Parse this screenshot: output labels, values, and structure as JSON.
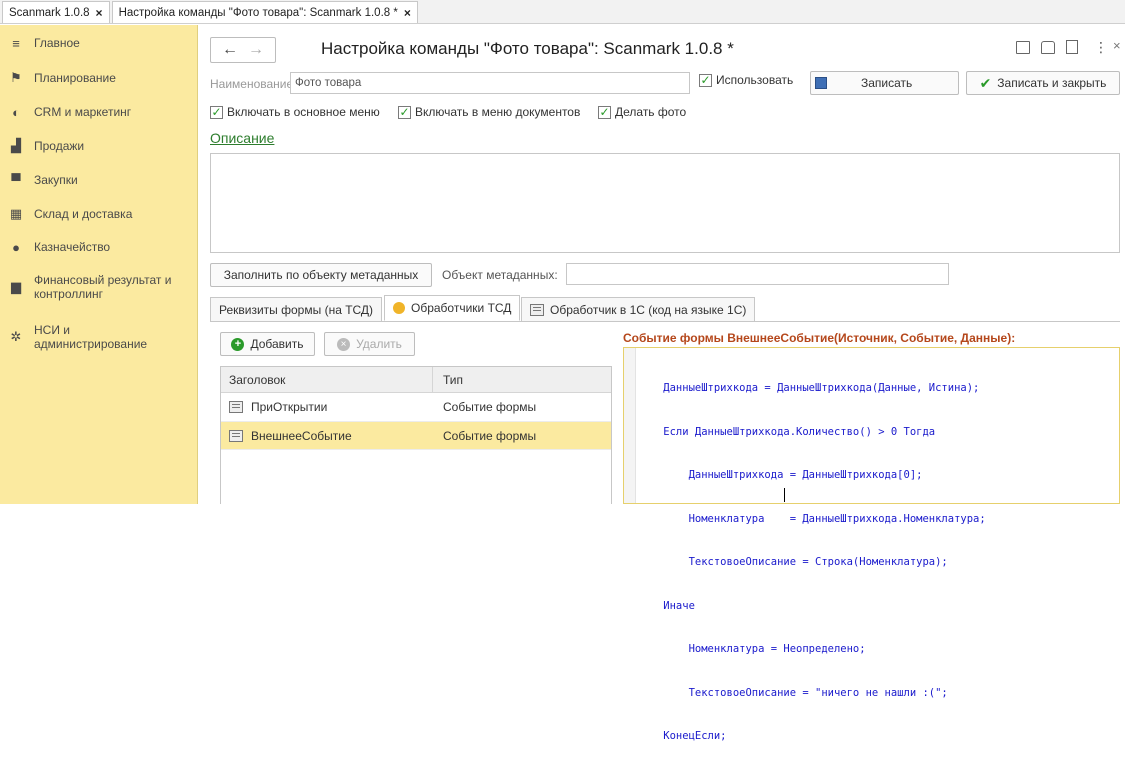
{
  "window_tabs": [
    {
      "label": "Scanmark 1.0.8",
      "close": "×"
    },
    {
      "label": "Настройка команды \"Фото товара\": Scanmark 1.0.8 *",
      "close": "×"
    }
  ],
  "sidebar": {
    "items": [
      {
        "label": "Главное",
        "icon": "menu-icon"
      },
      {
        "label": "Планирование",
        "icon": "planning-icon"
      },
      {
        "label": "CRM и маркетинг",
        "icon": "crm-icon"
      },
      {
        "label": "Продажи",
        "icon": "bag-icon"
      },
      {
        "label": "Закупки",
        "icon": "cart-icon"
      },
      {
        "label": "Склад и доставка",
        "icon": "warehouse-icon"
      },
      {
        "label": "Казначейство",
        "icon": "coin-icon"
      },
      {
        "label": "Финансовый результат и контроллинг",
        "icon": "chart-icon"
      },
      {
        "label": "НСИ и администрирование",
        "icon": "gear-icon"
      }
    ]
  },
  "header": {
    "back": "←",
    "forward": "→",
    "title": "Настройка команды \"Фото товара\": Scanmark 1.0.8 *",
    "more": "⋮",
    "close": "×"
  },
  "form": {
    "name_label": "Наименование:",
    "name_value": "Фото товара",
    "use_label": "Использовать",
    "save_label": "Записать",
    "save_close_label": "Записать и закрыть",
    "cb_main_menu": "Включать в основное меню",
    "cb_doc_menu": "Включать в меню документов",
    "cb_photo": "Делать фото",
    "description_link": "Описание",
    "fill_button": "Заполнить по объекту метаданных",
    "metadata_label": "Объект метаданных:",
    "metadata_value": ""
  },
  "tabs": [
    {
      "label": "Реквизиты формы (на ТСД)"
    },
    {
      "label": "Обработчики ТСД"
    },
    {
      "label": "Обработчик в 1С  (код на языке 1С)"
    }
  ],
  "handlers": {
    "add_label": "Добавить",
    "delete_label": "Удалить",
    "columns": [
      "Заголовок",
      "Тип"
    ],
    "rows": [
      {
        "title": "ПриОткрытии",
        "type": "Событие формы"
      },
      {
        "title": "ВнешнееСобытие",
        "type": "Событие формы"
      }
    ]
  },
  "code": {
    "header": "Событие формы ВнешнееСобытие(Источник, Событие, Данные):",
    "lines": [
      "    ДанныеШтрихкода = ДанныеШтрихкода(Данные, Истина);",
      "    Если ДанныеШтрихкода.Количество() > 0 Тогда",
      "        ДанныеШтрихкода = ДанныеШтрихкода[0];",
      "        Номенклатура    = ДанныеШтрихкода.Номенклатура;",
      "        ТекстовоеОписание = Строка(Номенклатура);",
      "    Иначе",
      "        Номенклатура = Неопределено;",
      "        ТекстовоеОписание = \"ничего не нашли :(\";",
      "    КонецЕсли;"
    ]
  },
  "colors": {
    "sidebar_bg": "#fbeaa0",
    "link_green": "#2d7d2d",
    "code_blue": "#1a1acc",
    "code_header": "#b5471b",
    "check_green": "#2a9a2a"
  }
}
